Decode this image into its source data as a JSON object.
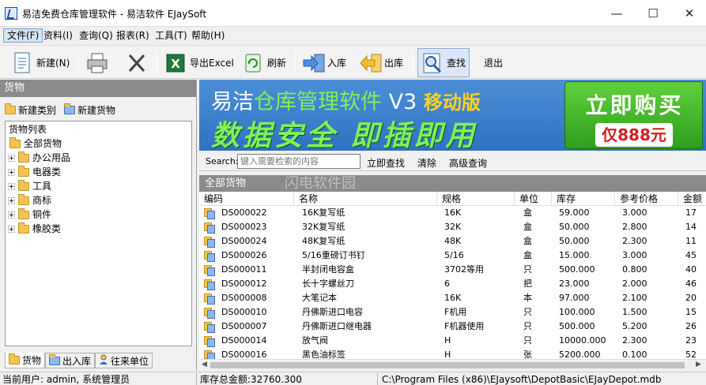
{
  "window": {
    "title": "易洁免费仓库管理软件 - 易洁软件 EJaySoft",
    "minimize": "—",
    "maximize": "☐",
    "close": "✕"
  },
  "menu": [
    {
      "label": "文件(F)"
    },
    {
      "label": "资料(I)"
    },
    {
      "label": "查询(Q)"
    },
    {
      "label": "报表(R)"
    },
    {
      "label": "工具(T)"
    },
    {
      "label": "帮助(H)"
    }
  ],
  "toolbar": {
    "new_label": "新建(N)",
    "export_label": "导出Excel",
    "refresh_label": "刷新",
    "stock_in_label": "入库",
    "stock_out_label": "出库",
    "find_label": "查找",
    "exit_label": "退出"
  },
  "left_panel": {
    "title": "货物",
    "new_category": "新建类别",
    "new_goods": "新建货物",
    "tree_title": "货物列表",
    "tree_root": "全部货物",
    "categories": [
      "办公用品",
      "电器类",
      "工具",
      "商标",
      "铜件",
      "橡胶类"
    ],
    "tabs": [
      "货物",
      "出入库",
      "往来单位"
    ]
  },
  "banner": {
    "line1_a": "易洁",
    "line1_b": "仓库管理软件",
    "line1_c": " V3 ",
    "line1_d": "移动版",
    "line2": "数据安全 即插即用",
    "buy": "立即购买",
    "price": "仅888元"
  },
  "search": {
    "label": "Search:",
    "placeholder": "键入需要检索的内容",
    "search_now": "立即查找",
    "clear": "清除",
    "advanced": "高级查询"
  },
  "grid": {
    "title": "全部货物",
    "watermark": "闪电软件园",
    "columns": [
      "编码",
      "名称",
      "规格",
      "单位",
      "库存",
      "参考价格",
      "金额"
    ],
    "rows": [
      {
        "code": "DS000022",
        "name": "16K复写纸",
        "spec": "16K",
        "unit": "盒",
        "stock": "59.000",
        "price": "3.000",
        "amount": "17"
      },
      {
        "code": "DS000023",
        "name": "32K复写纸",
        "spec": "32K",
        "unit": "盒",
        "stock": "50.000",
        "price": "2.800",
        "amount": "14"
      },
      {
        "code": "DS000024",
        "name": "48K复写纸",
        "spec": "48K",
        "unit": "盒",
        "stock": "50.000",
        "price": "2.300",
        "amount": "11"
      },
      {
        "code": "DS000026",
        "name": "5/16重磅订书钉",
        "spec": "5/16",
        "unit": "盒",
        "stock": "15.000",
        "price": "3.000",
        "amount": "45"
      },
      {
        "code": "DS000011",
        "name": "半封闭电容盒",
        "spec": "3702等用",
        "unit": "只",
        "stock": "500.000",
        "price": "0.800",
        "amount": "40"
      },
      {
        "code": "DS000012",
        "name": "长十字螺丝刀",
        "spec": "6",
        "unit": "把",
        "stock": "23.000",
        "price": "2.000",
        "amount": "46"
      },
      {
        "code": "DS000008",
        "name": "大笔记本",
        "spec": "16K",
        "unit": "本",
        "stock": "97.000",
        "price": "2.100",
        "amount": "20"
      },
      {
        "code": "DS000010",
        "name": "丹佛斯进口电容",
        "spec": "F机用",
        "unit": "只",
        "stock": "100.000",
        "price": "1.500",
        "amount": "15"
      },
      {
        "code": "DS000007",
        "name": "丹佛斯进口继电器",
        "spec": "F机器使用",
        "unit": "只",
        "stock": "500.000",
        "price": "5.200",
        "amount": "26"
      },
      {
        "code": "DS000014",
        "name": "放气阀",
        "spec": "H",
        "unit": "只",
        "stock": "10000.000",
        "price": "2.300",
        "amount": "23"
      },
      {
        "code": "DS000016",
        "name": "黑色油标签",
        "spec": "H",
        "unit": "张",
        "stock": "5200.000",
        "price": "0.100",
        "amount": "52"
      }
    ]
  },
  "status": {
    "user": "当前用户: admin, 系统管理员",
    "total": "库存总金额:32760.300",
    "path": "C:\\Program Files (x86)\\EJaysoft\\DepotBasic\\EJayDepot.mdb"
  },
  "colors": {
    "panel_header": "#8a8a8a",
    "banner_blue": "#2e72c2",
    "banner_green": "#7cf25a",
    "buy_green": "#2f9e1e",
    "price_red": "#d42020"
  }
}
